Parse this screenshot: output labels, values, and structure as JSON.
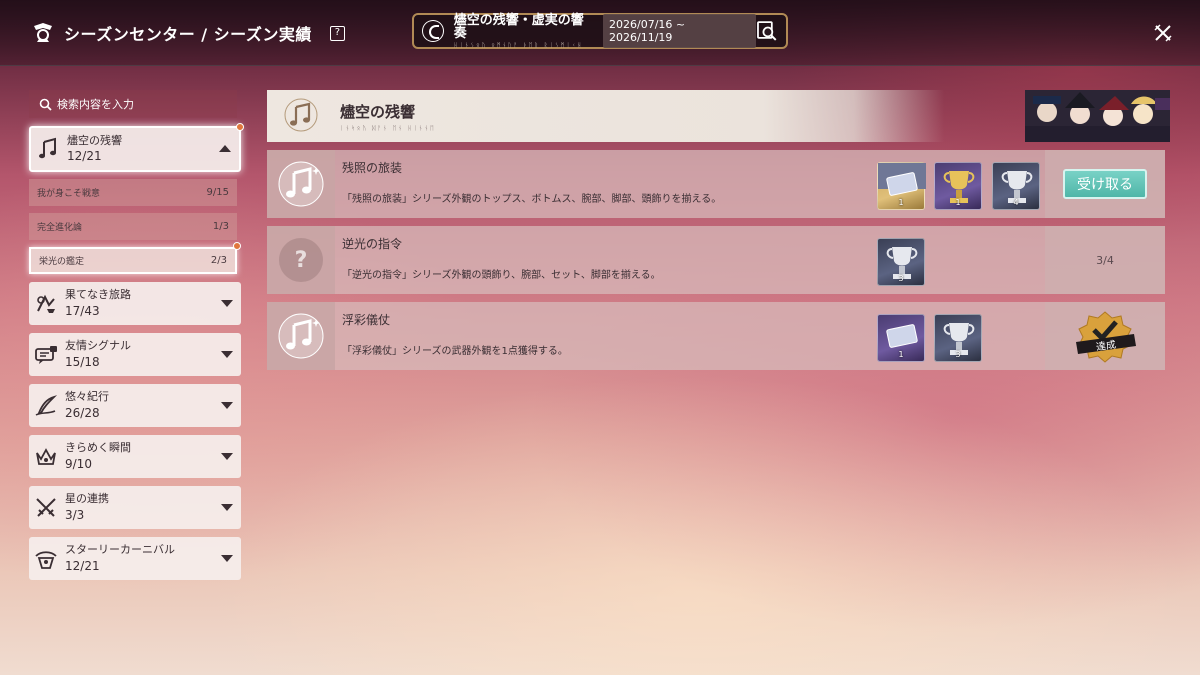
{
  "header": {
    "title": "シーズンセンター / シーズン実績",
    "help_label": "?",
    "season_name": "燼空の残響・虚実の響奏",
    "season_subtitle": "ᚺᛁᚾᛊᛟᚢ ᛟᛗᚾᚢᚨ ᚦᛖᚱ ᚱᛁᛊᛗᛁᚲᚺ",
    "season_dates": "2026/07/16 ~ 2026/11/19",
    "icons": [
      "season-emblem-icon",
      "search-season-icon",
      "close-icon"
    ]
  },
  "sidebar": {
    "search_placeholder": "検索内容を入力",
    "categories": [
      {
        "name": "燼空の残響",
        "count": "12/21",
        "icon": "music-note-icon",
        "expanded": true,
        "badge": true,
        "subs": [
          {
            "name": "我が身こそ戦意",
            "count": "9/15"
          },
          {
            "name": "完全進化論",
            "count": "1/3"
          },
          {
            "name": "栄光の鑑定",
            "count": "2/3",
            "active": true,
            "badge": true
          }
        ]
      },
      {
        "name": "果てなき旅路",
        "count": "17/43",
        "icon": "journey-icon"
      },
      {
        "name": "友情シグナル",
        "count": "15/18",
        "icon": "chat-icon"
      },
      {
        "name": "悠々紀行",
        "count": "26/28",
        "icon": "quill-icon"
      },
      {
        "name": "きらめく瞬間",
        "count": "9/10",
        "icon": "crown-icon"
      },
      {
        "name": "星の連携",
        "count": "3/3",
        "icon": "crossed-swords-icon"
      },
      {
        "name": "スターリーカーニバル",
        "count": "12/21",
        "icon": "carnival-icon"
      }
    ]
  },
  "main": {
    "banner_title": "燼空の残響",
    "banner_subtitle": "ᛁᚾᛋᛟᚢ ᛞᚨᚾ ᛖᚾ ᚺᛁᚾᚾᛖ",
    "achievements": [
      {
        "name": "残照の旅装",
        "desc": "「残照の旅装」シリーズ外観のトップス、ボトムス、腕部、脚部、頭飾りを揃える。",
        "rewards": [
          {
            "type": "ticket",
            "bg": "blue-gold",
            "qty": "1"
          },
          {
            "type": "trophy-gold",
            "bg": "purple",
            "qty": "1"
          },
          {
            "type": "trophy-silver",
            "bg": "dark",
            "qty": "4"
          }
        ],
        "status": "claim",
        "claim_label": "受け取る"
      },
      {
        "name": "逆光の指令",
        "desc": "「逆光の指令」シリーズ外観の頭飾り、腕部、セット、脚部を揃える。",
        "rewards": [
          {
            "type": "trophy-silver",
            "bg": "dark",
            "qty": "3"
          }
        ],
        "status": "progress",
        "progress": "3/4",
        "locked": true
      },
      {
        "name": "浮彩儀仗",
        "desc": "「浮彩儀仗」シリーズの武器外観を1点獲得する。",
        "rewards": [
          {
            "type": "ticket",
            "bg": "purple",
            "qty": "1"
          },
          {
            "type": "trophy-silver",
            "bg": "dark",
            "qty": "3"
          }
        ],
        "status": "done",
        "done_label": "達成"
      }
    ]
  },
  "colors": {
    "claim": "#4fb6a8",
    "badge": "#e0773d",
    "gold": "#c8a35a"
  }
}
